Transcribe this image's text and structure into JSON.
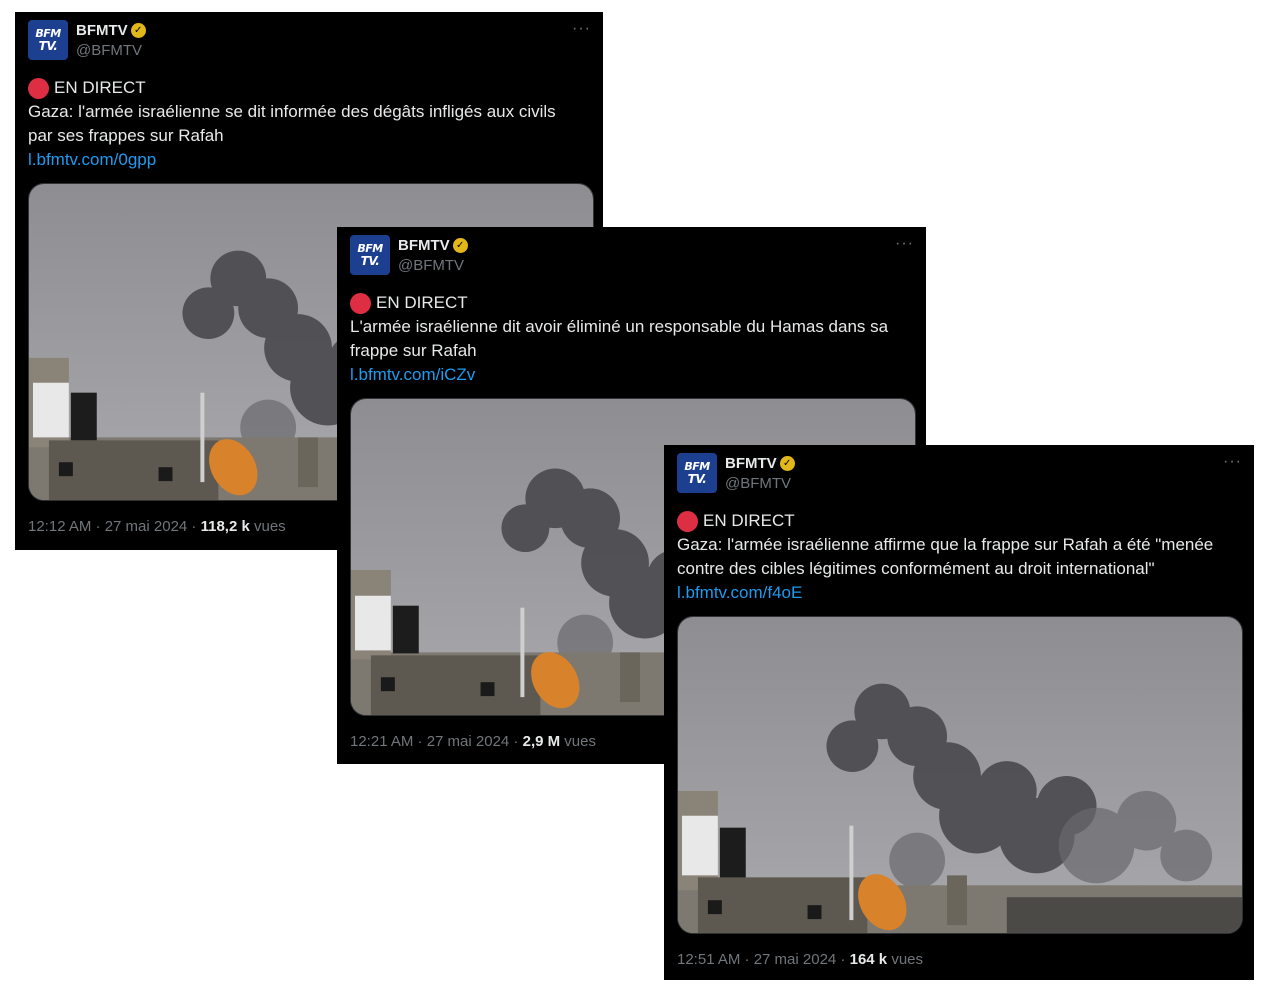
{
  "tweets": [
    {
      "account_name": "BFMTV",
      "handle": "@BFMTV",
      "avatar_line1": "BFM",
      "avatar_line2": "TV.",
      "badge_icon": "verified-gold-badge-icon",
      "more_icon": "···",
      "live_label": "EN DIRECT",
      "text": "Gaza: l'armée israélienne se dit informée des dégâts infligés aux civils par ses frappes sur Rafah",
      "link": "l.bfmtv.com/0gpp",
      "time": "12:12 AM · 27 mai 2024 · ",
      "views_count": "118,2 k",
      "views_label": " vues"
    },
    {
      "account_name": "BFMTV",
      "handle": "@BFMTV",
      "avatar_line1": "BFM",
      "avatar_line2": "TV.",
      "badge_icon": "verified-gold-badge-icon",
      "more_icon": "···",
      "live_label": "EN DIRECT",
      "text": "L'armée israélienne dit avoir éliminé un responsable du Hamas dans sa frappe sur Rafah",
      "link": "l.bfmtv.com/iCZv",
      "time": "12:21 AM · 27 mai 2024 · ",
      "views_count": "2,9 M",
      "views_label": " vues"
    },
    {
      "account_name": "BFMTV",
      "handle": "@BFMTV",
      "avatar_line1": "BFM",
      "avatar_line2": "TV.",
      "badge_icon": "verified-gold-badge-icon",
      "more_icon": "···",
      "live_label": "EN DIRECT",
      "text": "Gaza: l'armée israélienne affirme que la frappe sur Rafah a été \"menée contre des cibles légitimes conformément au droit international\"",
      "link": "l.bfmtv.com/f4oE",
      "time": "12:51 AM · 27 mai 2024 · ",
      "views_count": "164 k",
      "views_label": " vues"
    }
  ],
  "colors": {
    "background": "#000000",
    "text": "#e7e9ea",
    "muted": "#71767b",
    "link": "#1d9bf0",
    "live_dot": "#dd2e44",
    "avatar": "#1d3f8f",
    "badge": "#e2b719"
  }
}
